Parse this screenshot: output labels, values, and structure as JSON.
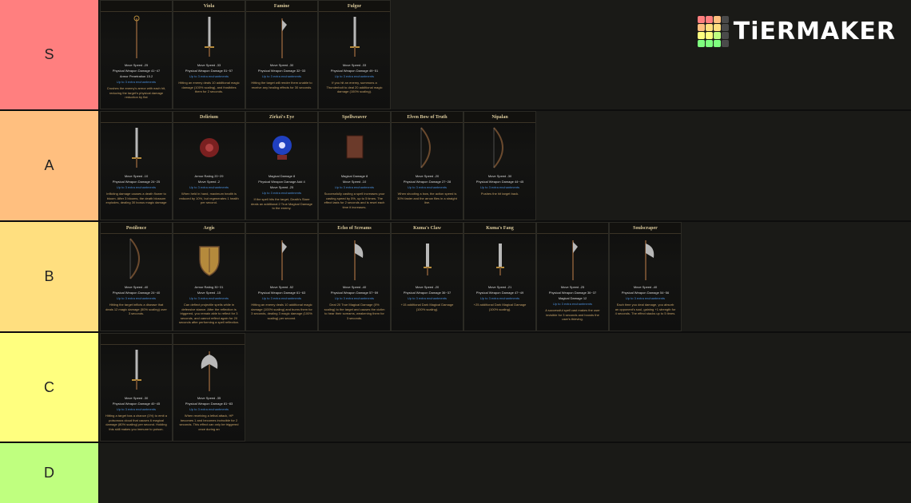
{
  "logo": {
    "text": "TiERMAKER",
    "grid_colors": [
      "#ff7f7f",
      "#ff7f7f",
      "#ffbf7f",
      "#4a4a4a",
      "#ffbf7f",
      "#ffdf7f",
      "#ffdf7f",
      "#4a4a4a",
      "#ffff7f",
      "#ffff7f",
      "#bfff7f",
      "#4a4a4a",
      "#7fff7f",
      "#7fff7f",
      "#7fff7f",
      "#4a4a4a"
    ],
    "icon": "tiermaker-logo-icon"
  },
  "tiers": [
    {
      "label": "S",
      "color": "#ff7f7f"
    },
    {
      "label": "A",
      "color": "#ffbf7f"
    },
    {
      "label": "B",
      "color": "#ffdf7f"
    },
    {
      "label": "C",
      "color": "#ffff7f"
    },
    {
      "label": "D",
      "color": "#bfff7f"
    }
  ],
  "items": [
    {
      "tier": 0,
      "title": "",
      "icon": "staff-icon",
      "stats": [
        "Move Speed -25",
        "Physical Weapon Damage 41~47",
        "Armor Penetration 15.2",
        "Up to 3 extra enchantments"
      ],
      "desc": "Crushes the enemy's armor with each hit, reducing the target's physical damage reduction by flat"
    },
    {
      "tier": 0,
      "title": "Viola",
      "icon": "longsword-icon",
      "stats": [
        "Move Speed -33",
        "Physical Weapon Damage 51~57",
        "Up to 3 extra enchantments"
      ],
      "desc": "Hitting an enemy deals 10 additional magic damage (100% scaling), and frostbites them for 2 seconds."
    },
    {
      "tier": 0,
      "title": "Famine",
      "icon": "halberd-icon",
      "stats": [
        "Move Speed -30",
        "Physical Weapon Damage 32~33",
        "Up to 3 extra enchantments"
      ],
      "desc": "Hitting the target will render them unable to receive any healing effects for 30 seconds."
    },
    {
      "tier": 0,
      "title": "Fulgor",
      "icon": "greatsword-icon",
      "stats": [
        "Move Speed -33",
        "Physical Weapon Damage 49~51",
        "Up to 3 extra enchantments"
      ],
      "desc": "If you hit an enemy, summons a Thunderbolt to deal 20 additional magic damage (100% scaling)."
    },
    {
      "tier": 1,
      "title": "",
      "icon": "sword-icon",
      "stats": [
        "Move Speed -10",
        "Physical Weapon Damage 24~25",
        "Up to 3 extra enchantments"
      ],
      "desc": "Inflicting damage causes a death flower to bloom. After 3 blooms, the death blossom explodes, dealing 30 bonus magic damage"
    },
    {
      "tier": 1,
      "title": "Delirium",
      "icon": "orb-icon",
      "stats": [
        "Armor Rating 20~29",
        "Move Speed -2",
        "Up to 3 extra enchantments"
      ],
      "desc": "When held in hand, maximum health is reduced by 10%, but regenerates 1 health per second."
    },
    {
      "tier": 1,
      "title": "Zirkzi's Eye",
      "icon": "eye-orb-icon",
      "stats": [
        "Magical Damage 8",
        "Physical Weapon Damage Add 4",
        "Move Speed -25",
        "Up to 3 extra enchantments"
      ],
      "desc": "If the spell hits the target, Death's Stare deals an additional 2 True Magical Damage to the enemy."
    },
    {
      "tier": 1,
      "title": "Spellweaver",
      "icon": "spellbook-icon",
      "stats": [
        "Magical Damage 8",
        "Move Speed -10",
        "Up to 3 extra enchantments"
      ],
      "desc": "Successfully casting a spell increases your casting speed by 5%, up to 5 times. The effect lasts for 2 seconds and is reset each time it increases."
    },
    {
      "tier": 1,
      "title": "Elven Bow of Truth",
      "icon": "longbow-icon",
      "stats": [
        "Move Speed -20",
        "Physical Weapon Damage 27~28",
        "Up to 3 extra enchantments"
      ],
      "desc": "When shooting a bow, the action speed is 30% faster and the arrow flies in a straight line."
    },
    {
      "tier": 1,
      "title": "Nipalan",
      "icon": "recurve-bow-icon",
      "stats": [
        "Move Speed -30",
        "Physical Weapon Damage 44~45",
        "Up to 3 extra enchantments"
      ],
      "desc": "Pushes the hit target back."
    },
    {
      "tier": 2,
      "title": "Pestilence",
      "icon": "bow-icon",
      "stats": [
        "Move Speed -40",
        "Physical Weapon Damage 24~40",
        "Up to 3 extra enchantments"
      ],
      "desc": "Hitting the target inflicts a disease that deals 12 magic damage (50% scaling) over 3 seconds."
    },
    {
      "tier": 2,
      "title": "Aegis",
      "icon": "shield-icon",
      "stats": [
        "Armor Rating 30~31",
        "Move Speed -15",
        "Up to 3 extra enchantments"
      ],
      "desc": "Can deflect projectile spells while in defensive stance. After the reflection is triggered, you remain able to reflect for 3 seconds, and cannot reflect again for 20 seconds after performing a spell reflection."
    },
    {
      "tier": 2,
      "title": "",
      "icon": "spear-icon",
      "stats": [
        "Move Speed -52",
        "Physical Weapon Damage 61~63",
        "Up to 3 extra enchantments"
      ],
      "desc": "Hitting an enemy deals 10 additional magic damage (100% scaling) and burns them for 3 seconds, dealing 3 magic damage (100% scaling) per second."
    },
    {
      "tier": 2,
      "title": "Echo of Screams",
      "icon": "battle-axe-icon",
      "stats": [
        "Move Speed -40",
        "Physical Weapon Damage 57~59",
        "Up to 3 extra enchantments"
      ],
      "desc": "Deal 20 True Magical Damage (0% scaling) to the target and causes the victim to hear their screams, weakening them for 3 seconds."
    },
    {
      "tier": 2,
      "title": "Kuma's Claw",
      "icon": "dagger-icon",
      "stats": [
        "Move Speed -20",
        "Physical Weapon Damage 36~37",
        "Up to 3 extra enchantments"
      ],
      "desc": "+15 additional Dark Magical Damage (100% scaling)."
    },
    {
      "tier": 2,
      "title": "Kuma's Fang",
      "icon": "short-sword-icon",
      "stats": [
        "Move Speed -21",
        "Physical Weapon Damage 47~49",
        "Up to 3 extra enchantments"
      ],
      "desc": "+25 additional Dark Magical Damage (100% scaling)."
    },
    {
      "tier": 2,
      "title": "",
      "icon": "wand-icon",
      "stats": [
        "Move Speed -25",
        "Physical Weapon Damage 36~37",
        "Magical Damage 12",
        "Up to 3 extra enchantments"
      ],
      "desc": "A successful spell cast makes the user invisible for 3 seconds and boosts the user's thieving."
    },
    {
      "tier": 2,
      "title": "Soulscraper",
      "icon": "axe-icon",
      "stats": [
        "Move Speed -40",
        "Physical Weapon Damage 54~56",
        "Up to 3 extra enchantments"
      ],
      "desc": "Each time you deal damage, you absorb an opponent's soul, gaining +1 strength for 4 seconds. The effect stacks up to 5 times."
    },
    {
      "tier": 3,
      "title": "",
      "icon": "rapier-icon",
      "stats": [
        "Move Speed -30",
        "Physical Weapon Damage 40~45",
        "Up to 3 extra enchantments"
      ],
      "desc": "Hitting a target has a chance (1%) to emit a poisonous cloud that causes 6 magical damage (80% scaling) per second. Holding this skill makes you immune to poison."
    },
    {
      "tier": 3,
      "title": "",
      "icon": "double-axe-icon",
      "stats": [
        "Move Speed -35",
        "Physical Weapon Damage 81~83",
        "Up to 3 extra enchantments"
      ],
      "desc": "When receiving a lethal attack, HP becomes 1 and becomes invincible for 2 seconds. This effect can only be triggered once during an"
    }
  ]
}
